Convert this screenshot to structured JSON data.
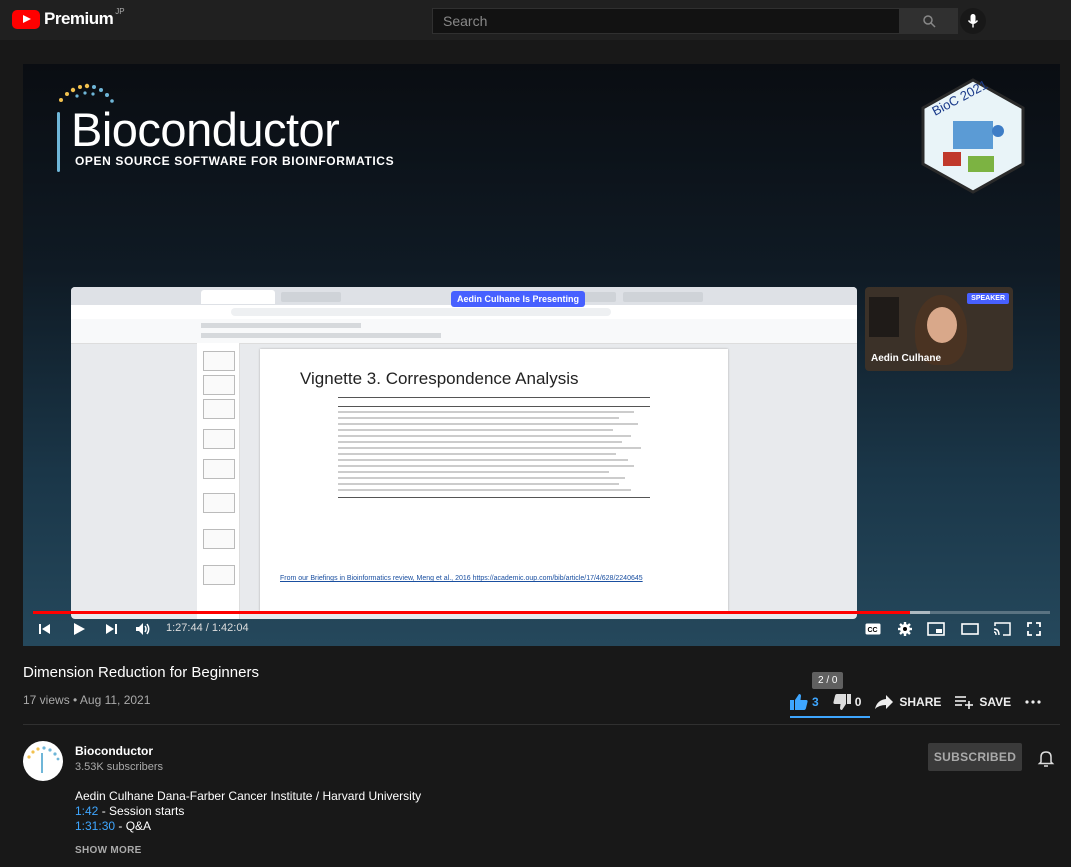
{
  "topbar": {
    "brand": "Premium",
    "region": "JP",
    "search_placeholder": "Search",
    "icons": [
      "youtube-logo-icon",
      "search-icon",
      "mic-icon"
    ]
  },
  "player": {
    "video_slide": {
      "bioconductor_title": "Bioconductor",
      "bioconductor_subtitle": "OPEN SOURCE SOFTWARE FOR BIOINFORMATICS",
      "hex_sticker_text": "BioC 2021",
      "presenting_banner": "Aedin Culhane Is Presenting",
      "slide_heading": "Vignette 3. Correspondence Analysis",
      "slide_footer_link": "From our Briefings in Bioinformatics review,  Meng et al., 2016 https://academic.oup.com/bib/article/17/4/628/2240645",
      "speaker_badge": "SPEAKER",
      "speaker_name": "Aedin Culhane"
    },
    "progress_fraction": 0.862,
    "time_display": "1:27:44 / 1:42:04",
    "controls": [
      "previous-icon",
      "play-icon",
      "next-icon",
      "volume-icon",
      "captions-icon",
      "settings-icon",
      "miniplayer-icon",
      "theater-icon",
      "cast-icon",
      "fullscreen-icon"
    ]
  },
  "video": {
    "title": "Dimension Reduction for Beginners",
    "meta": "17 views • Aug 11, 2021",
    "ratio_tooltip": "2 / 0",
    "likes": "3",
    "dislikes": "0",
    "share_label": "SHARE",
    "save_label": "SAVE"
  },
  "channel": {
    "name": "Bioconductor",
    "subscribers": "3.53K subscribers",
    "subscribe_label": "SUBSCRIBED"
  },
  "description": {
    "line1": "Aedin Culhane Dana-Farber Cancer Institute / Harvard University",
    "chapters": [
      {
        "time": "1:42",
        "label": " - Session starts"
      },
      {
        "time": "1:31:30",
        "label": " - Q&A"
      }
    ],
    "show_more": "SHOW MORE"
  },
  "colors": {
    "accent_red": "#ff0000",
    "link_blue": "#3ea6ff",
    "background": "#181818"
  }
}
